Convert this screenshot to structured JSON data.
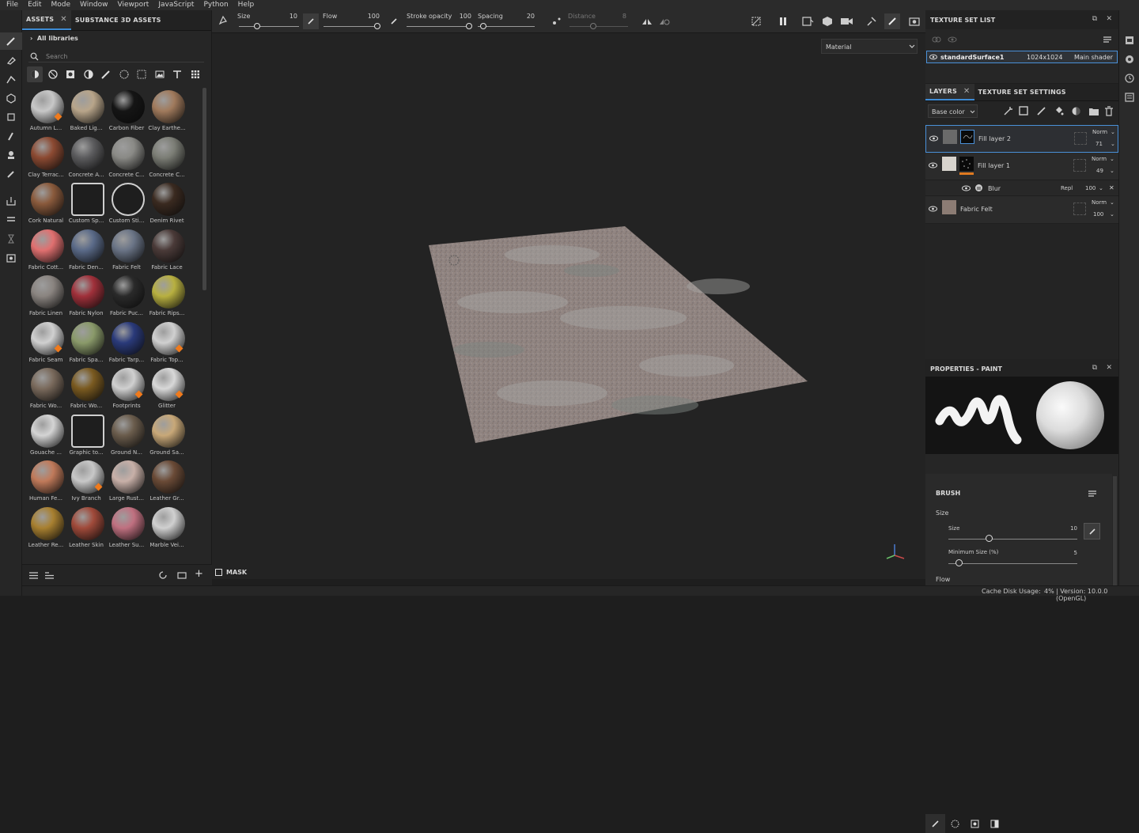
{
  "menu": [
    "File",
    "Edit",
    "Mode",
    "Window",
    "Viewport",
    "JavaScript",
    "Python",
    "Help"
  ],
  "assets_panel": {
    "tabs": [
      {
        "label": "ASSETS"
      },
      {
        "label": "SUBSTANCE 3D ASSETS"
      }
    ],
    "library": "All libraries",
    "search_placeholder": "Search",
    "materials": [
      {
        "label": "Autumn L...",
        "color": "#c8c8c8",
        "accent": "#8a3a1e",
        "badge": true
      },
      {
        "label": "Baked Lig...",
        "color": "#b8a58a",
        "badge": false
      },
      {
        "label": "Carbon Fiber",
        "color": "#151515",
        "badge": false
      },
      {
        "label": "Clay Earthe...",
        "color": "#a07a5c",
        "badge": false
      },
      {
        "label": "Clay Terrac...",
        "color": "#8c4a32",
        "badge": false
      },
      {
        "label": "Concrete A...",
        "color": "#5c5c5e",
        "badge": false
      },
      {
        "label": "Concrete C...",
        "color": "#8a8a86",
        "badge": false
      },
      {
        "label": "Concrete C...",
        "color": "#7c7e76",
        "badge": false
      },
      {
        "label": "Cork Natural",
        "color": "#8a5a3c",
        "badge": false
      },
      {
        "label": "Custom Sp...",
        "color": "#cfcfcf",
        "badge": false,
        "icon": true
      },
      {
        "label": "Custom Sti...",
        "color": "#cfcfcf",
        "badge": false,
        "icon": true
      },
      {
        "label": "Denim Rivet",
        "color": "#3a2a20",
        "badge": false
      },
      {
        "label": "Fabric Cott...",
        "color": "#e07070",
        "badge": false
      },
      {
        "label": "Fabric Den...",
        "color": "#5a6a88",
        "badge": false
      },
      {
        "label": "Fabric Felt",
        "color": "#6a7486",
        "badge": false
      },
      {
        "label": "Fabric Lace",
        "color": "#4a3a38",
        "badge": false
      },
      {
        "label": "Fabric Linen",
        "color": "#8a8480",
        "badge": false
      },
      {
        "label": "Fabric Nylon",
        "color": "#a0303a",
        "badge": false
      },
      {
        "label": "Fabric Puc...",
        "color": "#2a2a2a",
        "badge": false
      },
      {
        "label": "Fabric Rips...",
        "color": "#b8b040",
        "badge": false
      },
      {
        "label": "Fabric Seam",
        "color": "#d0d0d0",
        "badge": true
      },
      {
        "label": "Fabric Spa...",
        "color": "#8a9a6a",
        "badge": false
      },
      {
        "label": "Fabric Tarp...",
        "color": "#2a3a7a",
        "badge": false
      },
      {
        "label": "Fabric Top...",
        "color": "#d0d0d0",
        "badge": true
      },
      {
        "label": "Fabric Wo...",
        "color": "#7a6a5c",
        "badge": false
      },
      {
        "label": "Fabric Wo...",
        "color": "#7a5a20",
        "badge": false
      },
      {
        "label": "Footprints",
        "color": "#d0d0d0",
        "badge": true
      },
      {
        "label": "Glitter",
        "color": "#d8d8d8",
        "badge": true
      },
      {
        "label": "Gouache ...",
        "color": "#d4d4d4",
        "badge": false
      },
      {
        "label": "Graphic to...",
        "color": "#cfcfcf",
        "badge": false,
        "icon": true
      },
      {
        "label": "Ground N...",
        "color": "#6a5c4c",
        "badge": false
      },
      {
        "label": "Ground Sa...",
        "color": "#c8a878",
        "badge": false
      },
      {
        "label": "Human Fe...",
        "color": "#c07a5a",
        "badge": false
      },
      {
        "label": "Ivy Branch",
        "color": "#c8c8c8",
        "badge": true
      },
      {
        "label": "Large Rust...",
        "color": "#c8b0a8",
        "badge": false
      },
      {
        "label": "Leather Gr...",
        "color": "#6a4a36",
        "badge": false
      },
      {
        "label": "Leather Re...",
        "color": "#a88030",
        "badge": false
      },
      {
        "label": "Leather Skin",
        "color": "#a04a3a",
        "badge": false
      },
      {
        "label": "Leather Su...",
        "color": "#c07080",
        "badge": false
      },
      {
        "label": "Marble Vei...",
        "color": "#d0d0d0",
        "badge": false
      }
    ]
  },
  "toolbar": {
    "size_label": "Size",
    "size_value": "10",
    "flow_label": "Flow",
    "flow_value": "100",
    "opacity_label": "Stroke opacity",
    "opacity_value": "100",
    "spacing_label": "Spacing",
    "spacing_value": "20",
    "distance_label": "Distance",
    "distance_value": "8"
  },
  "viewport": {
    "channel_select": "Material",
    "mask_label": "MASK"
  },
  "texture_set_list": {
    "title": "TEXTURE SET LIST",
    "item": {
      "name": "standardSurface1",
      "resolution": "1024x1024",
      "shader": "Main shader"
    }
  },
  "layers": {
    "tabs": [
      {
        "label": "LAYERS"
      },
      {
        "label": "TEXTURE SET SETTINGS"
      }
    ],
    "channel": "Base color",
    "items": [
      {
        "name": "Fill layer 2",
        "blend": "Norm",
        "opacity": "71"
      },
      {
        "name": "Fill layer 1",
        "blend": "Norm",
        "opacity": "49"
      },
      {
        "name": "Blur",
        "blend": "Repl",
        "opacity": "100"
      },
      {
        "name": "Fabric Felt",
        "blend": "Norm",
        "opacity": "100"
      }
    ]
  },
  "properties": {
    "title": "PROPERTIES - PAINT",
    "brush_title": "BRUSH",
    "size_group": "Size",
    "size_label": "Size",
    "size_value": "10",
    "min_size_label": "Minimum Size (%)",
    "min_size_value": "5",
    "flow_label": "Flow"
  },
  "status": {
    "cache": "Cache Disk Usage:",
    "cache_value": "4%",
    "version": "| Version: 10.0.0 (OpenGL)"
  }
}
